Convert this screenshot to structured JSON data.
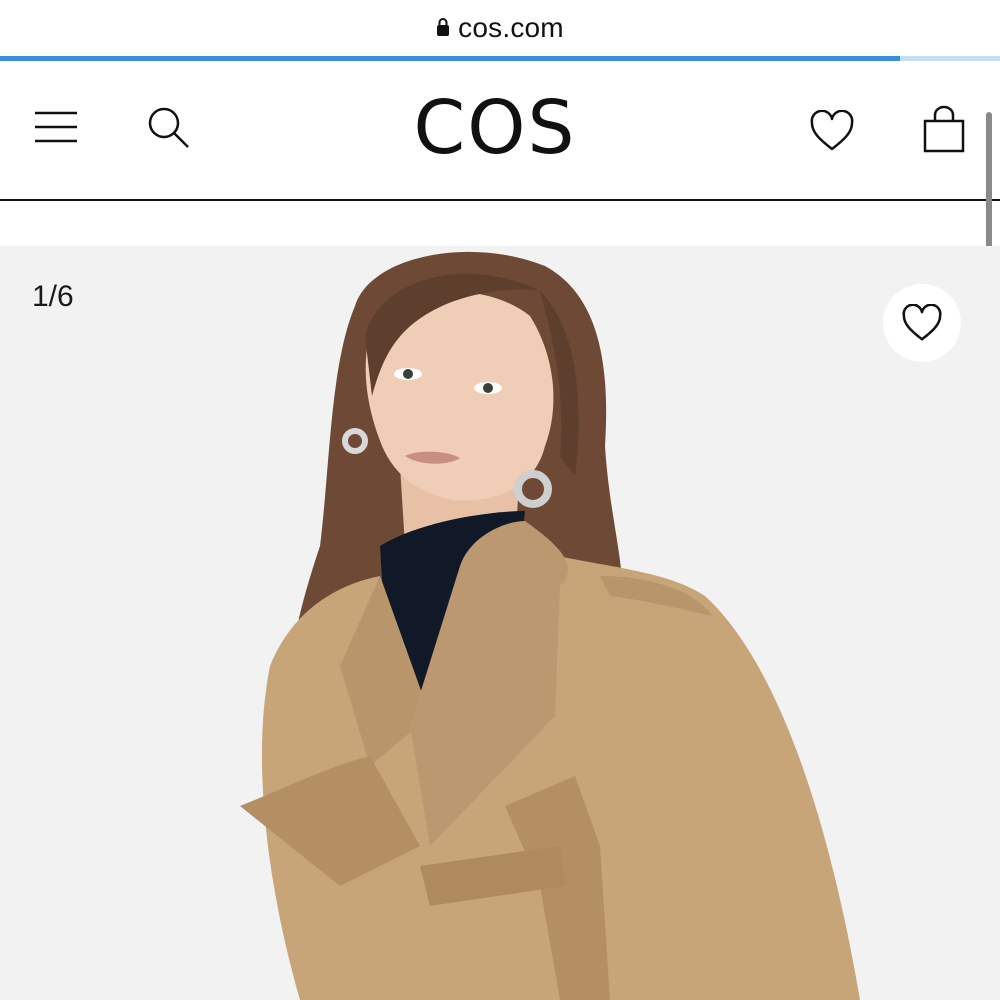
{
  "browser": {
    "url": "cos.com",
    "load_progress": 0.9
  },
  "header": {
    "logo": "COS",
    "icons": {
      "menu": "hamburger-menu-icon",
      "search": "search-icon",
      "favorites": "heart-icon",
      "bag": "shopping-bag-icon"
    }
  },
  "gallery": {
    "counter": "1/6",
    "wishlist_icon": "heart-icon"
  },
  "colors": {
    "progress_bar": "#3b8fd6",
    "gallery_background": "#f1f2f1",
    "coat": "#c8a578"
  }
}
